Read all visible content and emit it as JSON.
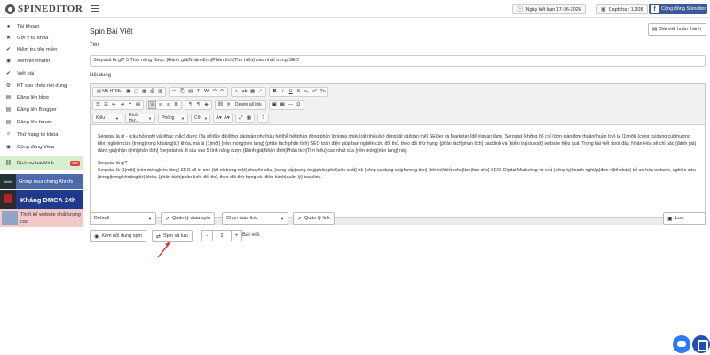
{
  "header": {
    "brand": "SPINEDITOR",
    "expiry": "Ngày hết hạn 17-06-2026",
    "captcha": "Captcha : 1.208",
    "community": "Cộng đồng Spinditor"
  },
  "sidebar": {
    "items": [
      {
        "label": "Tài khoản",
        "icon": "user-icon"
      },
      {
        "label": "Gợi ý từ khóa",
        "icon": "star-icon"
      },
      {
        "label": "Kiểm tra tên miền",
        "icon": "check-icon"
      },
      {
        "label": "Xem tin nhanh",
        "icon": "eye-icon"
      },
      {
        "label": "Viết bài",
        "icon": "check-icon"
      },
      {
        "label": "KT sao chép nội dung",
        "icon": "gear-icon"
      },
      {
        "label": "Đăng lên blog",
        "icon": "document-icon"
      },
      {
        "label": "Đăng lên Blogger",
        "icon": "document-icon"
      },
      {
        "label": "Đăng lên forum",
        "icon": "document-icon"
      },
      {
        "label": "Thứ hạng từ khóa",
        "icon": "search-icon"
      },
      {
        "label": "Cộng đồng View",
        "icon": "eye-icon"
      }
    ],
    "backlink": {
      "label": "Dịch vụ backlink",
      "badge": "new"
    },
    "ads": {
      "group": "Group mua chung Ahrefs",
      "group_thumb": "ahrefs",
      "dmca": "Kháng DMCA 24h",
      "design": "Thiết kế website chất lượng cao"
    }
  },
  "main": {
    "title": "Spin Bài Viết",
    "done_button": "Bài viết hoàn thành",
    "name_label": "Tên",
    "article_title": "Serpstat là gì? 5 Tính năng được {Đánh giá|Nhận định|Phân tích|Tìm hiểu} cao nhất trong SEO",
    "content_label": "Nội dung",
    "toolbar": {
      "source": "Mã HTML",
      "delete_link": "Delete all link",
      "style": "Kiểu",
      "format": "Định thư...",
      "font": "Phông",
      "size": "Cỡ"
    },
    "content_p1": "Serpstat là gì - {câu hỏi|nghi vấn|thắc mắc} được {đa số|đầy đủ|đông đảo|gần như|hầu hết|hễ hết|phần đông|phần lớn|quá nhiều|rất nhiều|số đông|tất cả|toàn thể} SEOer và Marketer {để ý|quan tâm}. Serpstat {khổng lồ} chỉ {đơn giản|đơn thuần|thuần túy} là {1|một} {công cụ|dụng cụ|phương tiện} nghiên cứu {trong|trong khoảng|từ} khóa, mà là {1|một} {nền móng|nền tảng} {phân tách|phân tích} SEO toàn diện giúp bạn nghiên cứu đối thủ, theo dõi thứ hạng, {phân tách|phân tích} backlink và {kiểm tra|rà soát} website hiệu quả. Trong bài viết dưới đây, Nhân Hòa sẽ chỉ bảo {đánh giá|đánh giá|nhận định|phân tích} Serpstat và đi sâu vào 5 tính năng được {Đánh giá|Nhận định|Phân tích|Tìm hiểu} cao nhất của {nền móng|nền tảng} này.",
    "content_h": "Serpstat là gì?",
    "content_p2": "Serpstat là {1|một} {nền móng|nền tảng} SEO all-in-one {tất cả trong một} chuyên sâu, {cung cấp|cung ứng|phân phối|sản xuất} bộ {công cụ|dụng cụ|phương tiện} {khiến|khiến cho|làm|làm cho} SEO, Digital Marketing và chủ {công ty|doanh nghiệp|đơn vị|tổ chức} tối ưu hóa website, nghiên cứu {trong|trong khoảng|từ} khóa, {phân tách|phân tích} đối thủ, theo dõi thứ hạng và {điều hành|quản lý} backlink.",
    "status_path": "body  p",
    "controls": {
      "default_select": "Default",
      "manage_spin": "Quản lý data spin",
      "choose_link": "Chọn data link",
      "manage_link": "Quản lý link",
      "save": "Lưu",
      "view_spin": "Xem nội dung spin",
      "spin_save": "Spin và lưu",
      "count": "2",
      "unit": "Bài viết",
      "minus": "-",
      "plus": "+"
    }
  },
  "colors": {
    "facebook": "#3b5998",
    "backlink_bg": "#d7efcf",
    "arrow": "#e0282e"
  }
}
